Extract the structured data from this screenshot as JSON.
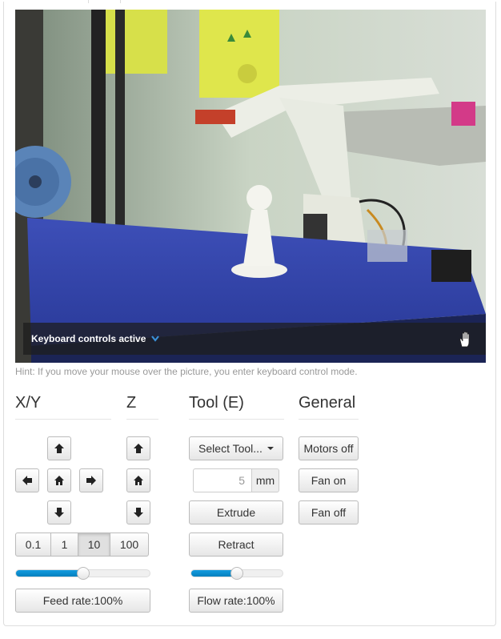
{
  "webcam": {
    "overlay_label": "Keyboard controls active",
    "hint": "Hint: If you move your mouse over the picture, you enter keyboard control mode."
  },
  "columns": {
    "xy": "X/Y",
    "z": "Z",
    "tool": "Tool (E)",
    "general": "General"
  },
  "jog": {
    "distances": [
      "0.1",
      "1",
      "10",
      "100"
    ],
    "selected_distance": "10",
    "feed_rate_label": "Feed rate:100%",
    "feed_rate_value": 0.5
  },
  "tool": {
    "select_label": "Select Tool...",
    "amount_placeholder": "5",
    "amount_unit": "mm",
    "extrude_label": "Extrude",
    "retract_label": "Retract",
    "flow_rate_label": "Flow rate:100%",
    "flow_rate_value": 0.5
  },
  "general": {
    "motors_off": "Motors off",
    "fan_on": "Fan on",
    "fan_off": "Fan off"
  },
  "colors": {
    "slider_fill": "#0480be",
    "overlay_accent": "#3a8fd8"
  }
}
